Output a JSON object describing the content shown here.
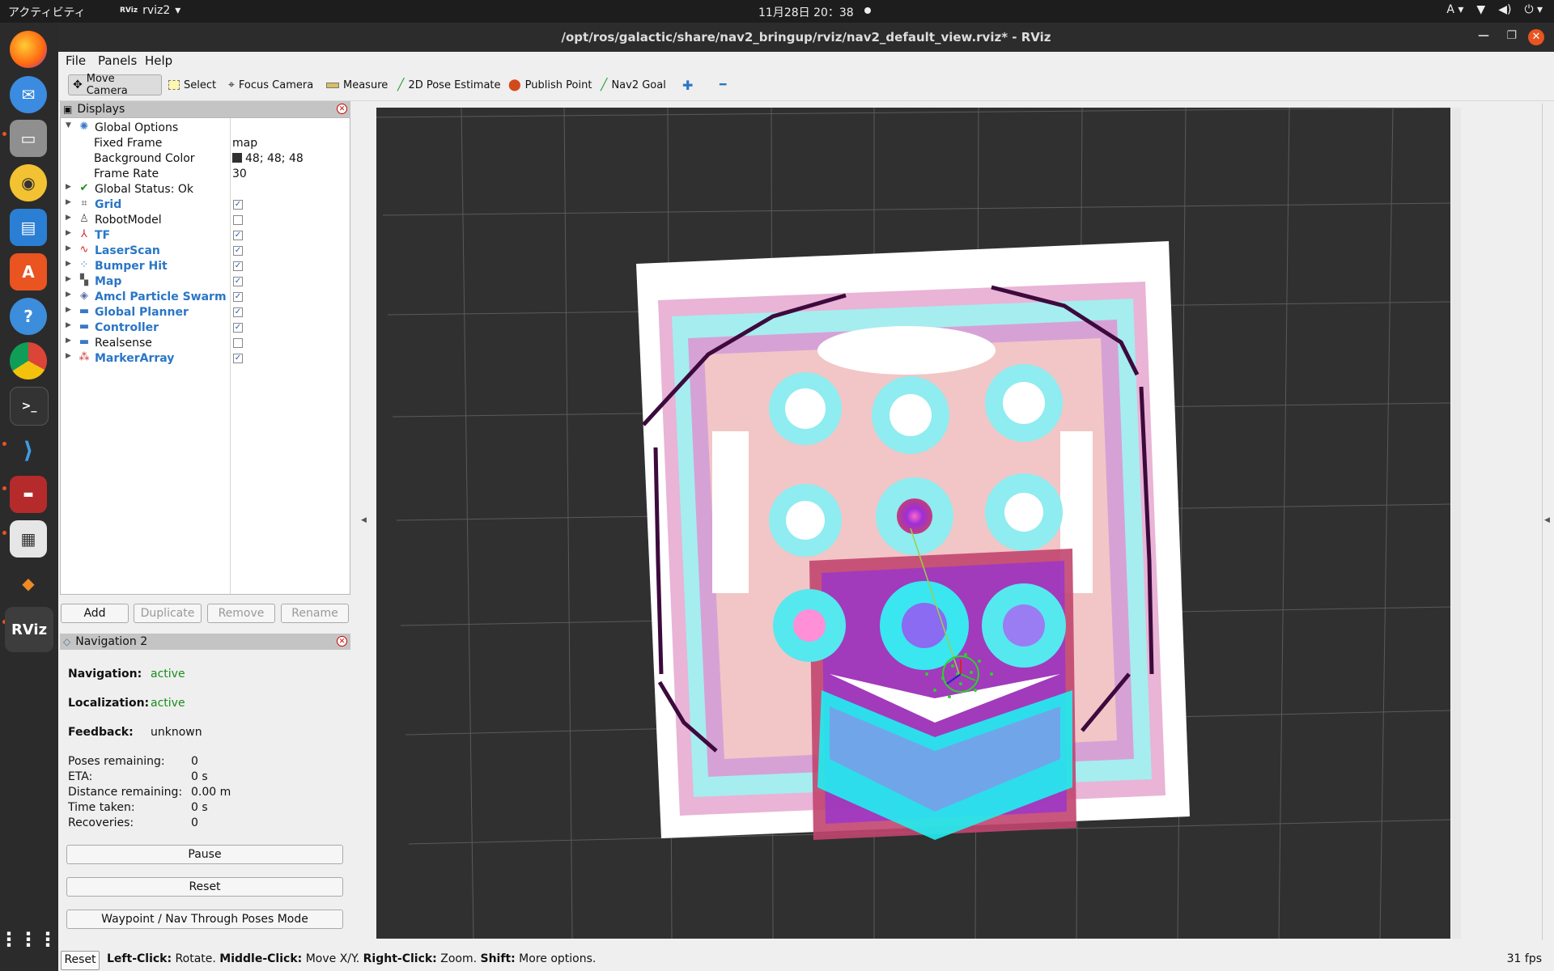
{
  "topbar": {
    "activities": "アクティビティ",
    "app_name": "rviz2",
    "app_logo": "RViz",
    "clock": "11月28日  20：38",
    "input_method": "A"
  },
  "window": {
    "title": "/opt/ros/galactic/share/nav2_bringup/rviz/nav2_default_view.rviz* - RViz"
  },
  "menu": {
    "file": "File",
    "panels": "Panels",
    "help": "Help"
  },
  "toolbar": {
    "move_camera": "Move Camera",
    "select": "Select",
    "focus_camera": "Focus Camera",
    "measure": "Measure",
    "pose_estimate": "2D Pose Estimate",
    "publish_point": "Publish Point",
    "nav2_goal": "Nav2 Goal"
  },
  "displays": {
    "header": "Displays",
    "global_options": "Global Options",
    "fixed_frame_label": "Fixed Frame",
    "fixed_frame_value": "map",
    "background_color_label": "Background Color",
    "background_color_value": "48; 48; 48",
    "frame_rate_label": "Frame Rate",
    "frame_rate_value": "30",
    "global_status": "Global Status: Ok",
    "items": [
      {
        "label": "Grid",
        "checked": true
      },
      {
        "label": "RobotModel",
        "checked": false
      },
      {
        "label": "TF",
        "checked": true
      },
      {
        "label": "LaserScan",
        "checked": true
      },
      {
        "label": "Bumper Hit",
        "checked": true
      },
      {
        "label": "Map",
        "checked": true
      },
      {
        "label": "Amcl Particle Swarm",
        "checked": true
      },
      {
        "label": "Global Planner",
        "checked": true
      },
      {
        "label": "Controller",
        "checked": true
      },
      {
        "label": "Realsense",
        "checked": false
      },
      {
        "label": "MarkerArray",
        "checked": true
      }
    ],
    "buttons": {
      "add": "Add",
      "duplicate": "Duplicate",
      "remove": "Remove",
      "rename": "Rename"
    }
  },
  "navigation": {
    "header": "Navigation 2",
    "navigation_label": "Navigation:",
    "navigation_value": "active",
    "localization_label": "Localization:",
    "localization_value": "active",
    "feedback_label": "Feedback:",
    "feedback_value": "unknown",
    "poses_remaining_label": "Poses remaining:",
    "poses_remaining_value": "0",
    "eta_label": "ETA:",
    "eta_value": "0 s",
    "distance_label": "Distance remaining:",
    "distance_value": "0.00 m",
    "time_taken_label": "Time taken:",
    "time_taken_value": "0 s",
    "recoveries_label": "Recoveries:",
    "recoveries_value": "0",
    "pause": "Pause",
    "reset": "Reset",
    "mode": "Waypoint / Nav Through Poses Mode"
  },
  "status": {
    "reset": "Reset",
    "left_click": "Left-Click:",
    "left_click_desc": " Rotate. ",
    "middle_click": "Middle-Click:",
    "middle_click_desc": " Move X/Y. ",
    "right_click": "Right-Click:",
    "right_click_desc": " Zoom. ",
    "shift": "Shift:",
    "shift_desc": " More options.",
    "fps": "31 fps"
  },
  "colors": {
    "background": "#303030",
    "status_active": "#1a8c1a",
    "display_label": "#2a76c6",
    "ubuntu_orange": "#e95420"
  }
}
